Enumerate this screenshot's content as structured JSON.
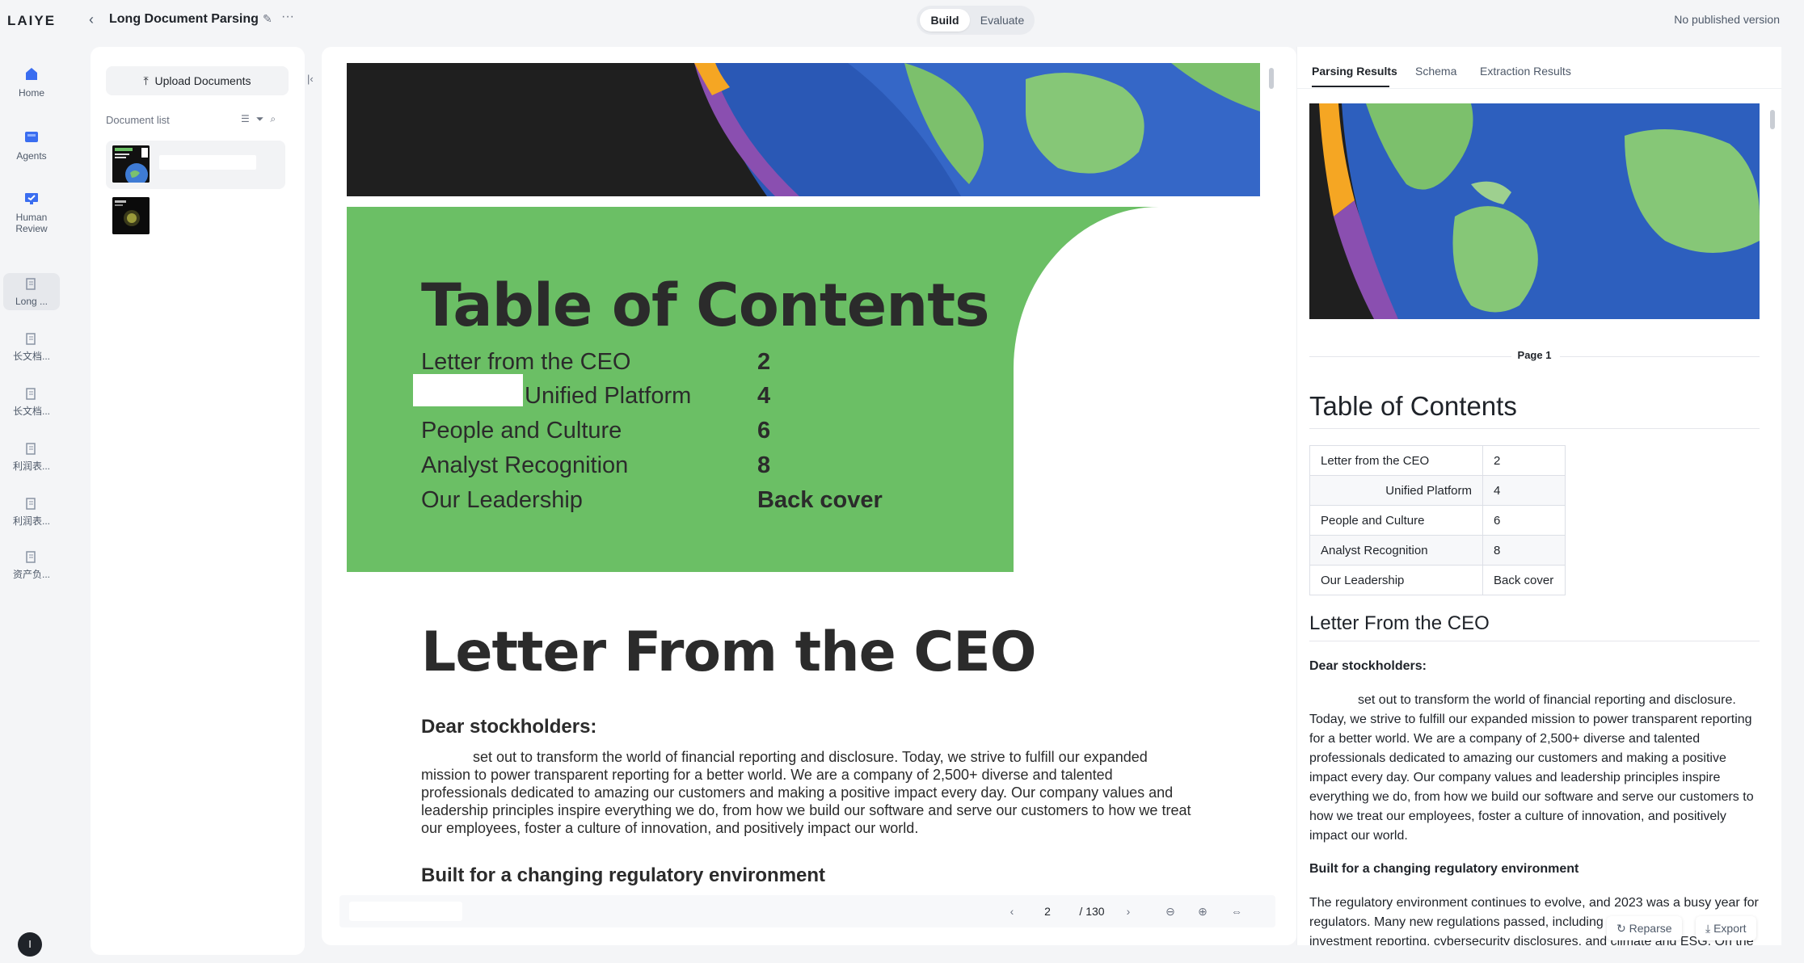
{
  "brand": {
    "logo": "LAIYE"
  },
  "nav": {
    "items": [
      {
        "label": "Home",
        "icon": "home-icon"
      },
      {
        "label": "Agents",
        "icon": "agents-icon"
      },
      {
        "label": "Human Review",
        "icon": "review-icon"
      },
      {
        "label": "Long ...",
        "icon": "document-icon"
      },
      {
        "label": "长文档...",
        "icon": "document-icon"
      },
      {
        "label": "长文档...",
        "icon": "document-icon"
      },
      {
        "label": "利润表...",
        "icon": "document-icon"
      },
      {
        "label": "利润表...",
        "icon": "document-icon"
      },
      {
        "label": "资产负...",
        "icon": "document-icon"
      }
    ],
    "avatar": "I"
  },
  "header": {
    "title": "Long Document Parsing",
    "modes": [
      "Build",
      "Evaluate"
    ],
    "active_mode": "Build",
    "publish_status": "No published version"
  },
  "docs": {
    "upload_label": "Upload Documents",
    "list_label": "Document list"
  },
  "viewer": {
    "toc_title": "Table of Contents",
    "toc": [
      {
        "label": "Letter from the CEO",
        "page": "2"
      },
      {
        "label": "Unified Platform",
        "page": "4"
      },
      {
        "label": "People and Culture",
        "page": "6"
      },
      {
        "label": "Analyst Recognition",
        "page": "8"
      },
      {
        "label": "Our Leadership",
        "page": "Back cover"
      }
    ],
    "letter_title": "Letter From the CEO",
    "dear": "Dear stockholders:",
    "letter_body": "set out to transform the world of financial reporting and disclosure. Today, we strive to fulfill our expanded mission to power transparent reporting for a better world. We are a company of 2,500+ diverse and talented professionals dedicated to amazing our customers and making a positive impact every day. Our company values and leadership principles inspire everything we do, from how we build our software and serve our customers to how we treat our employees, foster a culture of innovation, and positively impact our world.",
    "built_heading": "Built for a changing regulatory environment",
    "current_page": "2",
    "total_pages": "/ 130"
  },
  "results": {
    "tabs": [
      "Parsing Results",
      "Schema",
      "Extraction Results"
    ],
    "active_tab": "Parsing Results",
    "page_label": "Page 1",
    "toc_title": "Table of Contents",
    "toc": [
      {
        "label": "Letter from the CEO",
        "page": "2"
      },
      {
        "label": "Unified Platform",
        "page": "4"
      },
      {
        "label": "People and Culture",
        "page": "6"
      },
      {
        "label": "Analyst Recognition",
        "page": "8"
      },
      {
        "label": "Our Leadership",
        "page": "Back cover"
      }
    ],
    "letter_title": "Letter From the CEO",
    "dear": "Dear stockholders:",
    "para1": "set out to transform the world of financial reporting and disclosure. Today, we strive to fulfill our expanded mission to power transparent reporting for a better world. We are a company of 2,500+ diverse and talented professionals dedicated to amazing our customers and making a positive impact every day. Our company values and leadership principles inspire everything we do, from how we build our software and serve our customers to how we treat our employees, foster a culture of innovation, and positively impact our world.",
    "built_heading": "Built for a changing regulatory environment",
    "para2": "The regulatory environment continues to evolve, and 2023 was a busy year for regulators. Many new regulations passed, including",
    "para2_cont": "investment reporting, cybersecurity disclosures, and climate and ESG. On the",
    "reparse_label": "Reparse",
    "export_label": "Export"
  }
}
